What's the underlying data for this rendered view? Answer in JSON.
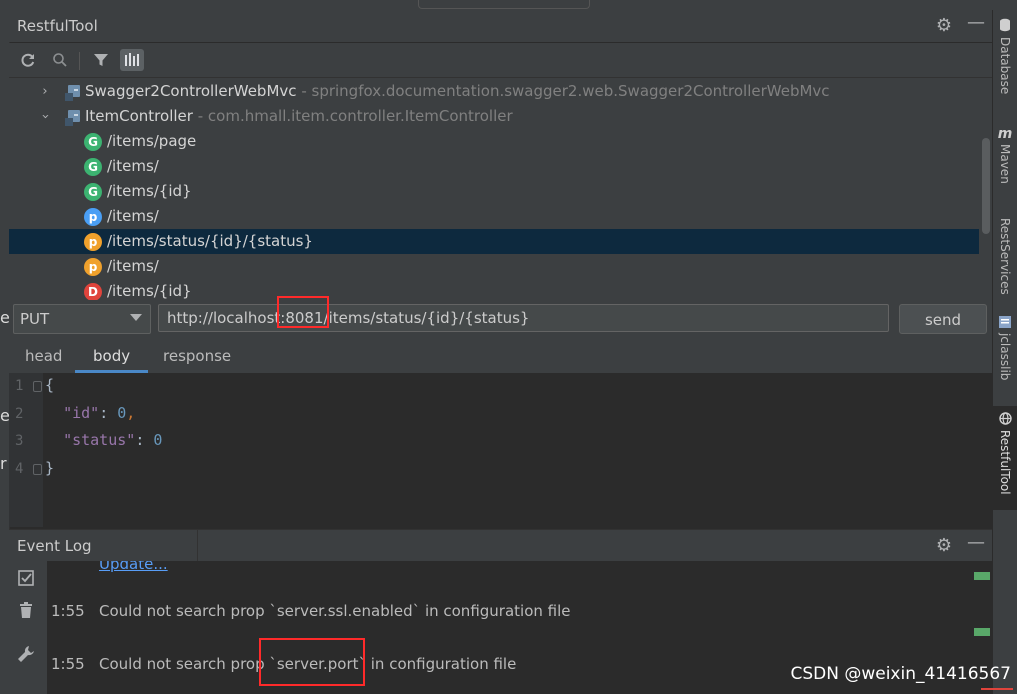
{
  "restful_panel": {
    "title": "RestfulTool",
    "settings_icon": "gear-icon",
    "minimize_icon": "minimize-icon"
  },
  "toolbar": {
    "icons": [
      "refresh-icon",
      "search-icon",
      "filter-icon",
      "method-filter-icon"
    ]
  },
  "tree": {
    "controllers": [
      {
        "name": "Swagger2ControllerWebMvc",
        "package": "springfox.documentation.swagger2.web.Swagger2ControllerWebMvc",
        "expanded": false
      },
      {
        "name": "ItemController",
        "package": "com.hmall.item.controller.ItemController",
        "expanded": true
      }
    ],
    "methods": [
      {
        "letter": "G",
        "color": "#3cb371",
        "path": "/items/page"
      },
      {
        "letter": "G",
        "color": "#3cb371",
        "path": "/items/"
      },
      {
        "letter": "G",
        "color": "#3cb371",
        "path": "/items/{id}"
      },
      {
        "letter": "p",
        "color": "#4a9ff5",
        "path": "/items/"
      },
      {
        "letter": "p",
        "color": "#f0a12c",
        "path": "/items/status/{id}/{status}",
        "selected": true
      },
      {
        "letter": "p",
        "color": "#f0a12c",
        "path": "/items/"
      },
      {
        "letter": "D",
        "color": "#e0443c",
        "path": "/items/{id}"
      }
    ]
  },
  "request": {
    "method": "PUT",
    "url": "http://localhost:8081/items/status/{id}/{status}",
    "send_label": "send"
  },
  "tabs": [
    {
      "label": "head",
      "active": false
    },
    {
      "label": "body",
      "active": true
    },
    {
      "label": "response",
      "active": false
    }
  ],
  "editor": {
    "line_numbers": [
      "1",
      "2",
      "3",
      "4"
    ],
    "id_key": "\"id\"",
    "id_value": "0",
    "status_key": "\"status\"",
    "status_value": "0",
    "open_brace": "{",
    "close_brace": "}",
    "colon": ": ",
    "comma": ","
  },
  "event_log": {
    "title": "Event Log",
    "partial_link": "Update...",
    "entries": [
      {
        "time": "1:55",
        "message": "Could not search prop `server.ssl.enabled` in configuration file"
      },
      {
        "time": "1:55",
        "message": "Could not search prop `server.port` in configuration file"
      }
    ]
  },
  "right_sidebar": [
    {
      "label": "Database",
      "icon": "database-icon"
    },
    {
      "label": "Maven",
      "icon": "maven-icon"
    },
    {
      "label": "RestServices",
      "icon": ""
    },
    {
      "label": "jclasslib",
      "icon": "jclasslib-icon"
    },
    {
      "label": "RestfulTool",
      "icon": "globe-icon",
      "active": true
    }
  ],
  "left_strip_chars": [
    "e",
    "e",
    "r"
  ],
  "watermark": "CSDN @weixin_41416567",
  "colors": {
    "selection": "#0d293e",
    "highlight_box": "#ff2a2a",
    "tab_accent": "#4a88c7"
  }
}
